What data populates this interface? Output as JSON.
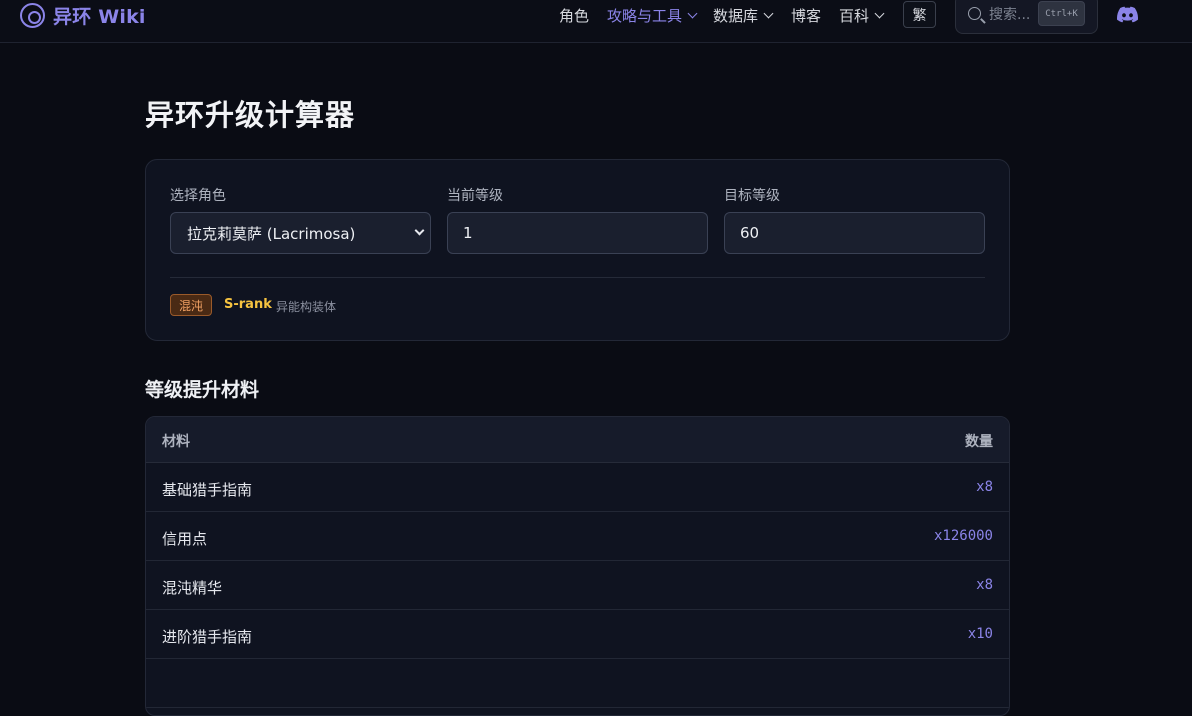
{
  "brand": {
    "name": "异环 Wiki"
  },
  "nav": {
    "items": [
      {
        "label": "角色"
      },
      {
        "label": "攻略与工具"
      },
      {
        "label": "数据库"
      },
      {
        "label": "博客"
      },
      {
        "label": "百科"
      }
    ],
    "lang_toggle": "繁",
    "search_placeholder": "搜索...",
    "search_shortcut": "Ctrl+K",
    "active_color": "#8b84e8"
  },
  "page": {
    "title": "异环升级计算器"
  },
  "calculator": {
    "character_label": "选择角色",
    "character_value": "拉克莉莫萨 (Lacrimosa)",
    "current_level_label": "当前等级",
    "current_level_value": "1",
    "target_level_label": "目标等级",
    "target_level_value": "60",
    "element_badge": "混沌",
    "rank": "S-rank",
    "type": "异能构装体"
  },
  "materials": {
    "section_title": "等级提升材料",
    "columns": [
      "材料",
      "数量"
    ],
    "rows": [
      {
        "name": "基础猎手指南",
        "qty": "x8"
      },
      {
        "name": "信用点",
        "qty": "x126000"
      },
      {
        "name": "混沌精华",
        "qty": "x8"
      },
      {
        "name": "进阶猎手指南",
        "qty": "x10"
      }
    ]
  }
}
